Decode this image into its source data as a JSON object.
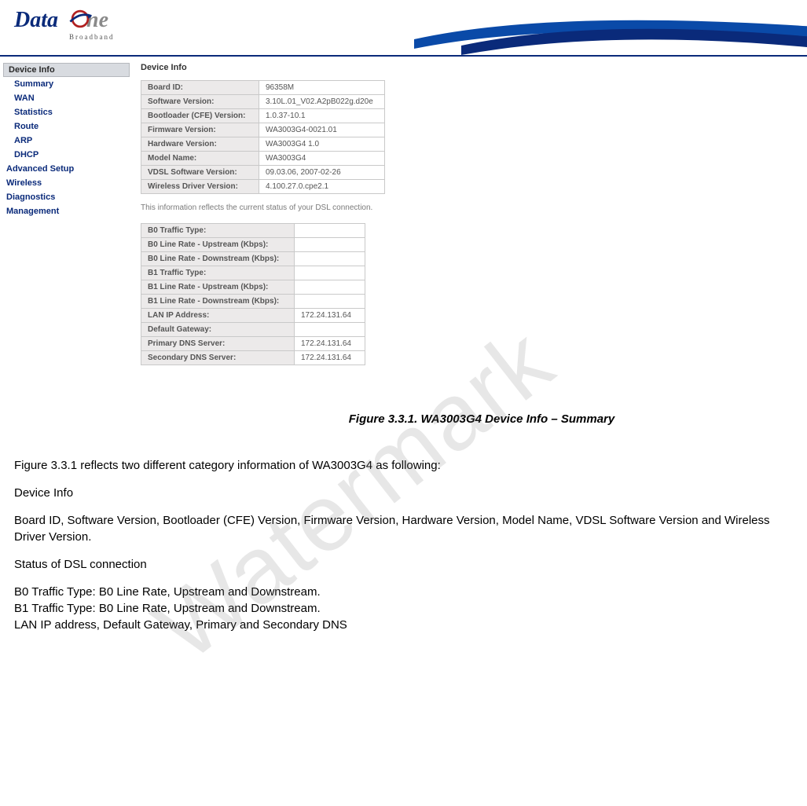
{
  "logo": {
    "part1": "Data",
    "part2": "ne",
    "sub": "Broadband"
  },
  "sidebar": {
    "header": "Device Info",
    "sub_items": [
      "Summary",
      "WAN",
      "Statistics",
      "Route",
      "ARP",
      "DHCP"
    ],
    "top_items": [
      "Advanced Setup",
      "Wireless",
      "Diagnostics",
      "Management"
    ]
  },
  "device_info": {
    "title": "Device Info",
    "rows": [
      {
        "k": "Board ID:",
        "v": "96358M"
      },
      {
        "k": "Software Version:",
        "v": "3.10L.01_V02.A2pB022g.d20e"
      },
      {
        "k": "Bootloader (CFE) Version:",
        "v": "1.0.37-10.1"
      },
      {
        "k": "Firmware Version:",
        "v": "WA3003G4-0021.01"
      },
      {
        "k": "Hardware Version:",
        "v": "WA3003G4 1.0"
      },
      {
        "k": "Model Name:",
        "v": "WA3003G4"
      },
      {
        "k": "VDSL Software Version:",
        "v": "09.03.06, 2007-02-26"
      },
      {
        "k": "Wireless Driver Version:",
        "v": "4.100.27.0.cpe2.1"
      }
    ]
  },
  "dsl_note": "This information reflects the current status of your DSL connection.",
  "dsl_status": {
    "rows": [
      {
        "k": "B0 Traffic Type:",
        "v": ""
      },
      {
        "k": "B0 Line Rate - Upstream (Kbps):",
        "v": ""
      },
      {
        "k": "B0 Line Rate - Downstream (Kbps):",
        "v": ""
      },
      {
        "k": "B1 Traffic Type:",
        "v": ""
      },
      {
        "k": "B1 Line Rate - Upstream (Kbps):",
        "v": ""
      },
      {
        "k": "B1 Line Rate - Downstream (Kbps):",
        "v": ""
      },
      {
        "k": "LAN IP Address:",
        "v": "172.24.131.64"
      },
      {
        "k": "Default Gateway:",
        "v": ""
      },
      {
        "k": "Primary DNS Server:",
        "v": "172.24.131.64"
      },
      {
        "k": "Secondary DNS Server:",
        "v": "172.24.131.64"
      }
    ]
  },
  "caption": "Figure 3.3.1. WA3003G4 Device Info – Summary",
  "body": {
    "p1": "Figure 3.3.1 reflects two different category information of WA3003G4 as following:",
    "p2": "Device Info",
    "p3": "Board ID, Software Version, Bootloader (CFE) Version, Firmware Version, Hardware Version, Model Name, VDSL Software Version and Wireless Driver Version.",
    "p4": "Status of DSL connection",
    "p5": "B0 Traffic Type: B0 Line Rate, Upstream and Downstream.",
    "p6": "B1 Traffic Type: B0 Line Rate, Upstream and Downstream.",
    "p7": "LAN IP address, Default Gateway, Primary and Secondary DNS"
  },
  "watermark": "Watermark"
}
